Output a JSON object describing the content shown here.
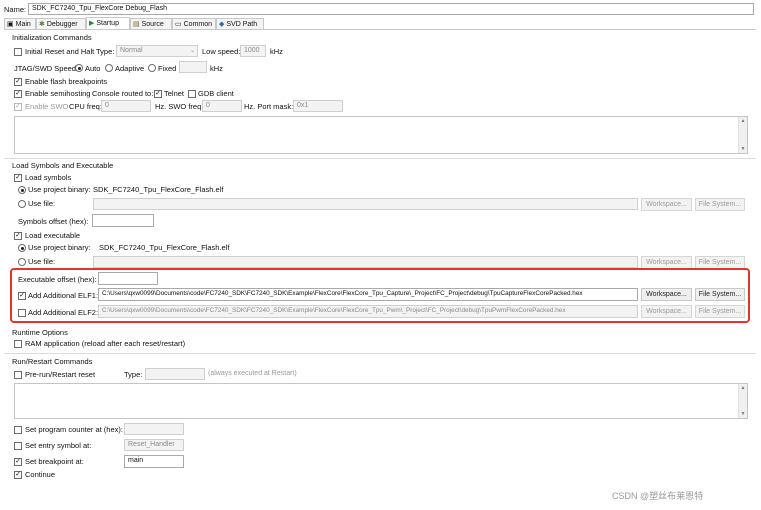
{
  "name_label": "Name:",
  "name_value": "SDK_FC7240_Tpu_FlexCore Debug_Flash",
  "tabs": [
    {
      "icon": "main-icon",
      "label": "Main"
    },
    {
      "icon": "debugger-icon",
      "label": "Debugger"
    },
    {
      "icon": "startup-icon",
      "label": "Startup"
    },
    {
      "icon": "source-icon",
      "label": "Source"
    },
    {
      "icon": "common-icon",
      "label": "Common"
    },
    {
      "icon": "svd-icon",
      "label": "SVD Path"
    }
  ],
  "init": {
    "title": "Initialization Commands",
    "initial_reset_label": "Initial Reset and Halt",
    "type_label": "Type:",
    "type_value": "Normal",
    "low_speed_label": "Low speed:",
    "low_speed_value": "1000",
    "khz": "kHz",
    "jtag_label": "JTAG/SWD Speed:",
    "auto_label": "Auto",
    "adaptive_label": "Adaptive",
    "fixed_label": "Fixed",
    "fixed_khz": "kHz",
    "flash_bp_label": "Enable flash breakpoints",
    "semihosting_label": "Enable semihosting",
    "console_routed_label": "Console routed to:",
    "telnet_label": "Telnet",
    "gdb_client_label": "GDB client",
    "swo_label": "Enable SWO",
    "cpu_freq_label": "CPU freq:",
    "cpu_freq_value": "0",
    "swo_freq_label": "Hz. SWO freq:",
    "swo_freq_value": "0",
    "port_mask_label": "Hz. Port mask:",
    "port_mask_value": "0x1"
  },
  "load": {
    "title": "Load Symbols and Executable",
    "load_symbols_label": "Load symbols",
    "use_project_binary_label": "Use project binary:",
    "symbols_binary": "SDK_FC7240_Tpu_FlexCore_Flash.elf",
    "use_file_label": "Use file:",
    "workspace_btn": "Workspace...",
    "filesystem_btn": "File System...",
    "symbols_offset_label": "Symbols offset (hex):",
    "load_exec_label": "Load executable",
    "exec_binary": "SDK_FC7240_Tpu_FlexCore_Flash.elf",
    "exec_offset_label": "Executable offset (hex):",
    "elf1_label": "Add Additional ELF1:",
    "elf1_path": "C:\\Users\\qxw0099\\Documents\\code\\FC7240_SDK\\FC7240_SDK\\Example\\FlexCore\\FlexCore_Tpu_Capture\\_Project\\FC_Project\\debug\\TpuCaptureFlexCorePacked.hex",
    "elf2_label": "Add Additional ELF2:",
    "elf2_path": "C:\\Users\\qxw0099\\Documents\\code\\FC7240_SDK\\FC7240_SDK\\Example\\FlexCore\\FlexCore_Tpu_Pwm\\_Project\\FC_Project\\debug\\TpuPwmFlexCorePacked.hex"
  },
  "runtime": {
    "title": "Runtime Options",
    "ram_app_label": "RAM application (reload after each reset/restart)"
  },
  "run": {
    "title": "Run/Restart Commands",
    "prerun_label": "Pre-run/Restart reset",
    "type_label": "Type:",
    "always_note": "(always executed at Restart)",
    "set_pc_label": "Set program counter at (hex):",
    "entry_symbol_label": "Set entry symbol at:",
    "entry_symbol_value": "Reset_Handler",
    "breakpoint_label": "Set breakpoint at:",
    "breakpoint_value": "main",
    "continue_label": "Continue"
  },
  "watermark": "CSDN @塑丝布莱恩特"
}
